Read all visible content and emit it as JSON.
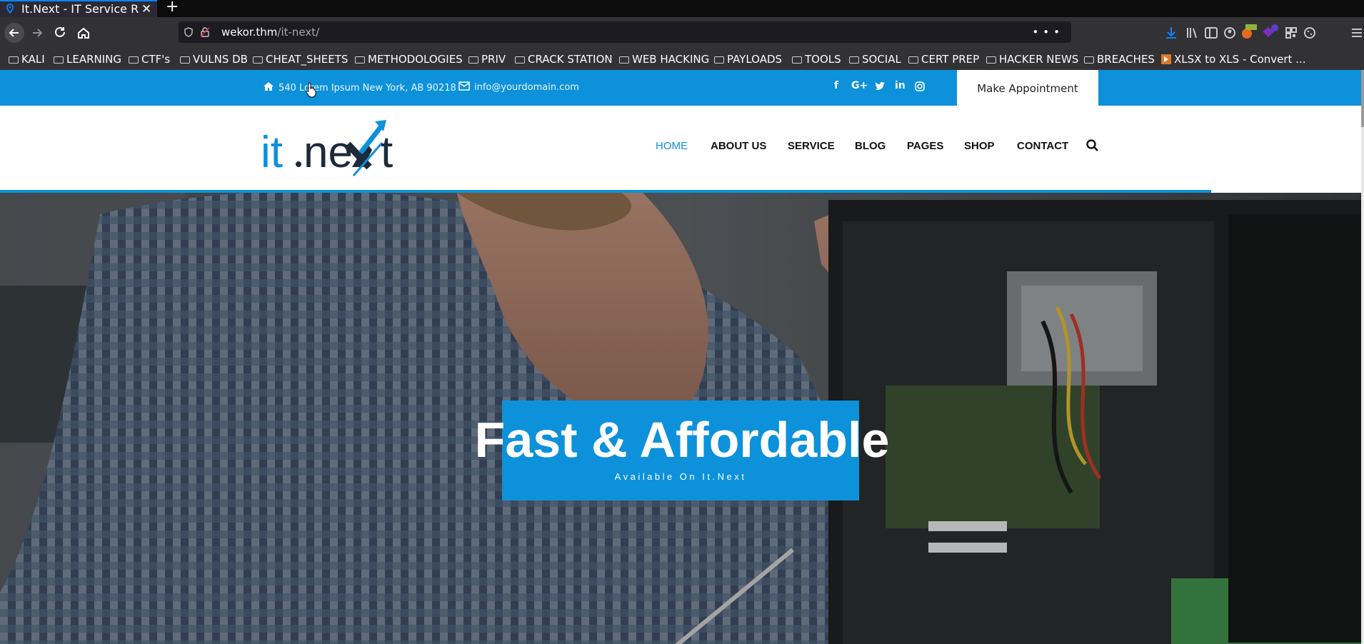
{
  "browser": {
    "tab_title": "It.Next - IT Service Respo",
    "url_host": "wekor.thm",
    "url_path": "/it-next/",
    "new_tab": "+",
    "tab_close": "✕",
    "url_more": "•••",
    "icons": {
      "back": "arrow-left-icon",
      "forward": "arrow-right-icon",
      "reload": "reload-icon",
      "home": "home-icon"
    }
  },
  "bookmarks": [
    {
      "label": "KALI"
    },
    {
      "label": "LEARNING"
    },
    {
      "label": "CTF's"
    },
    {
      "label": "VULNS DB"
    },
    {
      "label": "CHEAT_SHEETS"
    },
    {
      "label": "METHODOLOGIES"
    },
    {
      "label": "PRIV"
    },
    {
      "label": "CRACK STATION"
    },
    {
      "label": "WEB HACKING"
    },
    {
      "label": "PAYLOADS"
    },
    {
      "label": "TOOLS"
    },
    {
      "label": "SOCIAL"
    },
    {
      "label": "CERT PREP"
    },
    {
      "label": "HACKER NEWS"
    },
    {
      "label": "BREACHES"
    },
    {
      "label": "XLSX to XLS - Convert ..."
    }
  ],
  "topbar": {
    "address": "540 Lorem Ipsum New York, AB 90218",
    "email": "info@yourdomain.com",
    "social": [
      "f",
      "G+",
      "t",
      "in",
      "ig"
    ],
    "appointment": "Make Appointment"
  },
  "nav": {
    "items": [
      "HOME",
      "ABOUT US",
      "SERVICE",
      "BLOG",
      "PAGES",
      "SHOP",
      "CONTACT"
    ],
    "active_index": 0
  },
  "loading_progress": 0.888,
  "hero": {
    "title": "Fast & Affordable",
    "subtitle": "Available On It.Next"
  },
  "colors": {
    "brand": "#0d91db",
    "dark": "#1d2a3a"
  }
}
